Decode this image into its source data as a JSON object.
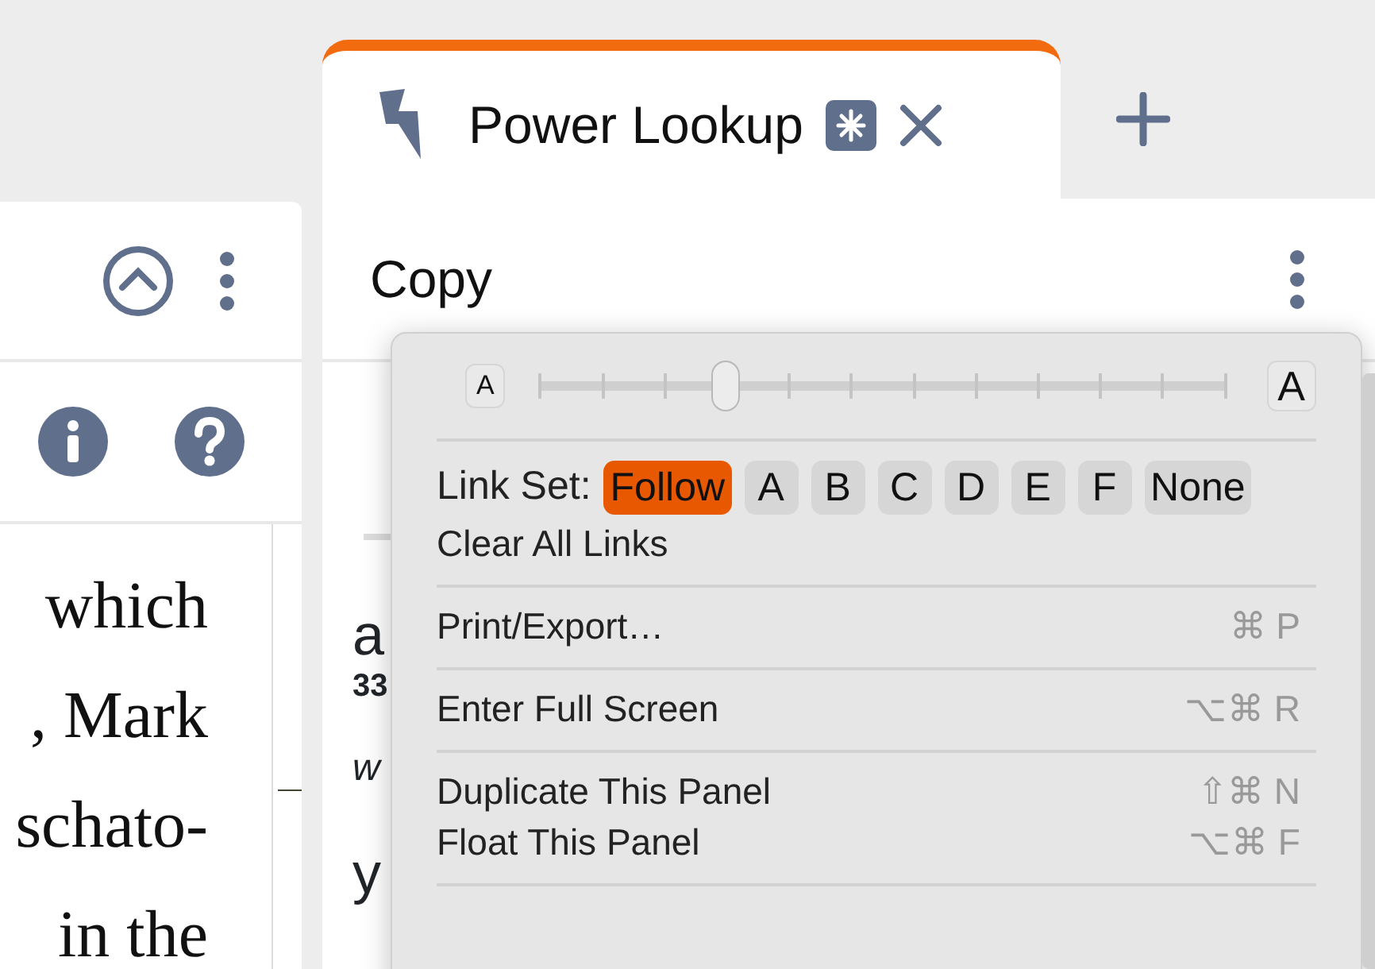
{
  "left_panel": {
    "text_lines": [
      "which",
      ", Mark",
      "schato-",
      "in the"
    ]
  },
  "tab": {
    "title": "Power Lookup",
    "selected": true
  },
  "right_panel": {
    "header": "Copy",
    "content": [
      {
        "kind": "word",
        "text": "a"
      },
      {
        "kind": "number",
        "text": "33"
      },
      {
        "kind": "italic",
        "text": "w"
      },
      {
        "kind": "word",
        "text": "y"
      }
    ]
  },
  "menu": {
    "font_size": {
      "small_label": "A",
      "large_label": "A",
      "level": 0.27
    },
    "link_set": {
      "label": "Link Set:",
      "options": [
        {
          "label": "Follow",
          "selected": true
        },
        {
          "label": "A",
          "selected": false
        },
        {
          "label": "B",
          "selected": false
        },
        {
          "label": "C",
          "selected": false
        },
        {
          "label": "D",
          "selected": false
        },
        {
          "label": "E",
          "selected": false
        },
        {
          "label": "F",
          "selected": false
        },
        {
          "label": "None",
          "selected": false
        }
      ]
    },
    "sections": [
      [
        {
          "label": "Clear All Links"
        }
      ],
      [
        {
          "label": "Print/Export…",
          "shortcut": "⌘ P"
        }
      ],
      [
        {
          "label": "Enter Full Screen",
          "shortcut": "⌥⌘ R"
        }
      ],
      [
        {
          "label": "Duplicate This Panel",
          "shortcut": "⇧⌘ N"
        },
        {
          "label": "Float This Panel",
          "shortcut": "⌥⌘ F"
        }
      ]
    ]
  }
}
